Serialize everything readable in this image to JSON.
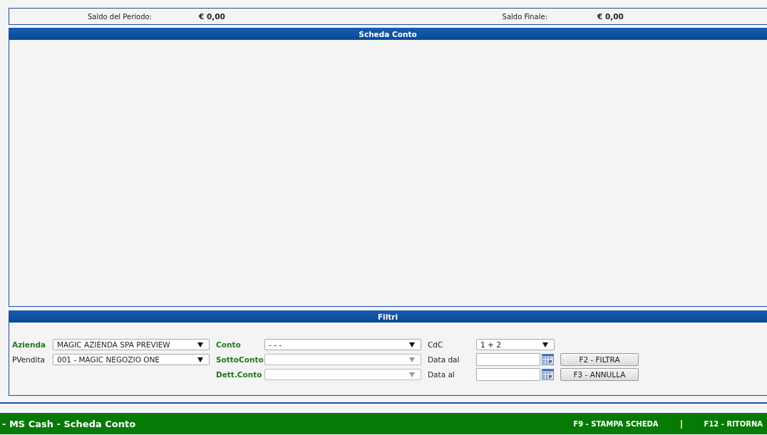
{
  "summary": [
    {
      "label": "Saldo del Periodo:",
      "value": "€ 0,00"
    },
    {
      "label": "Saldo Finale:",
      "value": "€ 0,00"
    }
  ],
  "main_panel": {
    "title": "Scheda Conto"
  },
  "filters": {
    "title": "Filtri",
    "rows": [
      {
        "fields": [
          {
            "label": "Azienda",
            "required": true,
            "kind": "select",
            "value": "MAGIC AZIENDA SPA PREVIEW",
            "disabled": false
          },
          {
            "label": "Conto",
            "required": true,
            "kind": "select",
            "value": "- - -",
            "disabled": false
          },
          {
            "label": "CdC",
            "required": false,
            "kind": "select",
            "value": "1 + 2",
            "disabled": false
          }
        ]
      },
      {
        "fields": [
          {
            "label": "PVendita",
            "required": false,
            "kind": "select",
            "value": "001 - MAGIC NEGOZIO ONE",
            "disabled": false
          },
          {
            "label": "SottoConto",
            "required": true,
            "kind": "select",
            "disabled": true
          },
          {
            "label": "Data dal",
            "required": false,
            "kind": "date"
          }
        ],
        "button": "F2 - FILTRA"
      },
      {
        "fields": [
          {
            "label": "Dett.Conto",
            "required": true,
            "kind": "select",
            "disabled": true
          },
          {
            "label": "Data al",
            "required": false,
            "kind": "date"
          }
        ],
        "button": "F3 - ANNULLA"
      }
    ]
  },
  "footer": {
    "title": "- MS Cash - Scheda Conto",
    "actions": [
      "F9 - STAMPA SCHEDA",
      "F12 - RITORNA"
    ]
  }
}
